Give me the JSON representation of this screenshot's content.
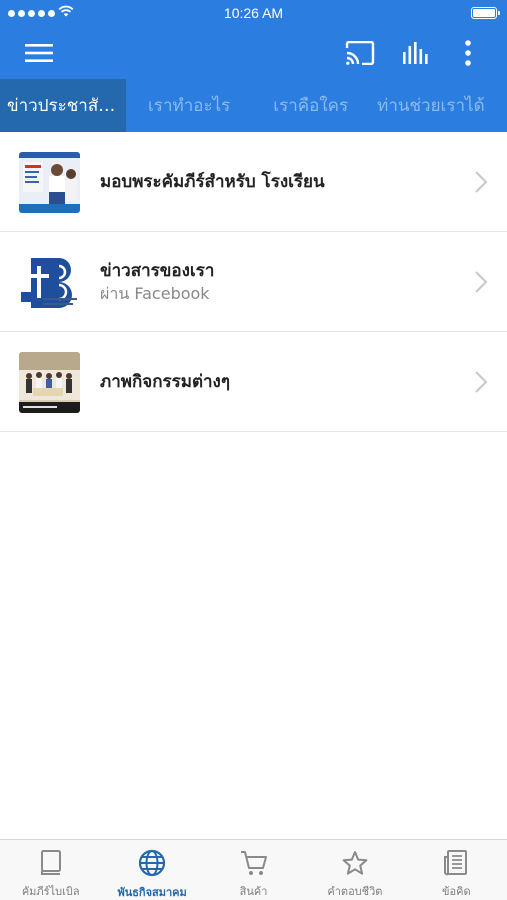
{
  "status_bar": {
    "time": "10:26 AM"
  },
  "colors": {
    "primary": "#2b7ee0",
    "tab_active": "#2468ad",
    "tab_inactive_text": "#8cb9ef"
  },
  "app_bar": {
    "icons": [
      "menu-icon",
      "cast-icon",
      "audio-levels-icon",
      "more-vert-icon"
    ]
  },
  "tabs": [
    {
      "label": "ข่าวประชาสัมพันธ์"
    },
    {
      "label": "เราทำอะไร"
    },
    {
      "label": "เราคือใคร"
    },
    {
      "label": "ท่านช่วยเราได้"
    }
  ],
  "list": [
    {
      "title": "มอบพระคัมภีร์สำหรับ โรงเรียน",
      "subtitle": ""
    },
    {
      "title": "ข่าวสารของเรา",
      "subtitle": "ผ่าน Facebook"
    },
    {
      "title": "ภาพกิจกรรมต่างๆ",
      "subtitle": ""
    }
  ],
  "bottom_nav": [
    {
      "label": "คัมภีร์ไบเบิล",
      "icon": "book-icon"
    },
    {
      "label": "พันธกิจสมาคม",
      "icon": "globe-icon"
    },
    {
      "label": "สินค้า",
      "icon": "cart-icon"
    },
    {
      "label": "คำตอบชีวิต",
      "icon": "star-icon"
    },
    {
      "label": "ข้อคิด",
      "icon": "newspaper-icon"
    }
  ]
}
